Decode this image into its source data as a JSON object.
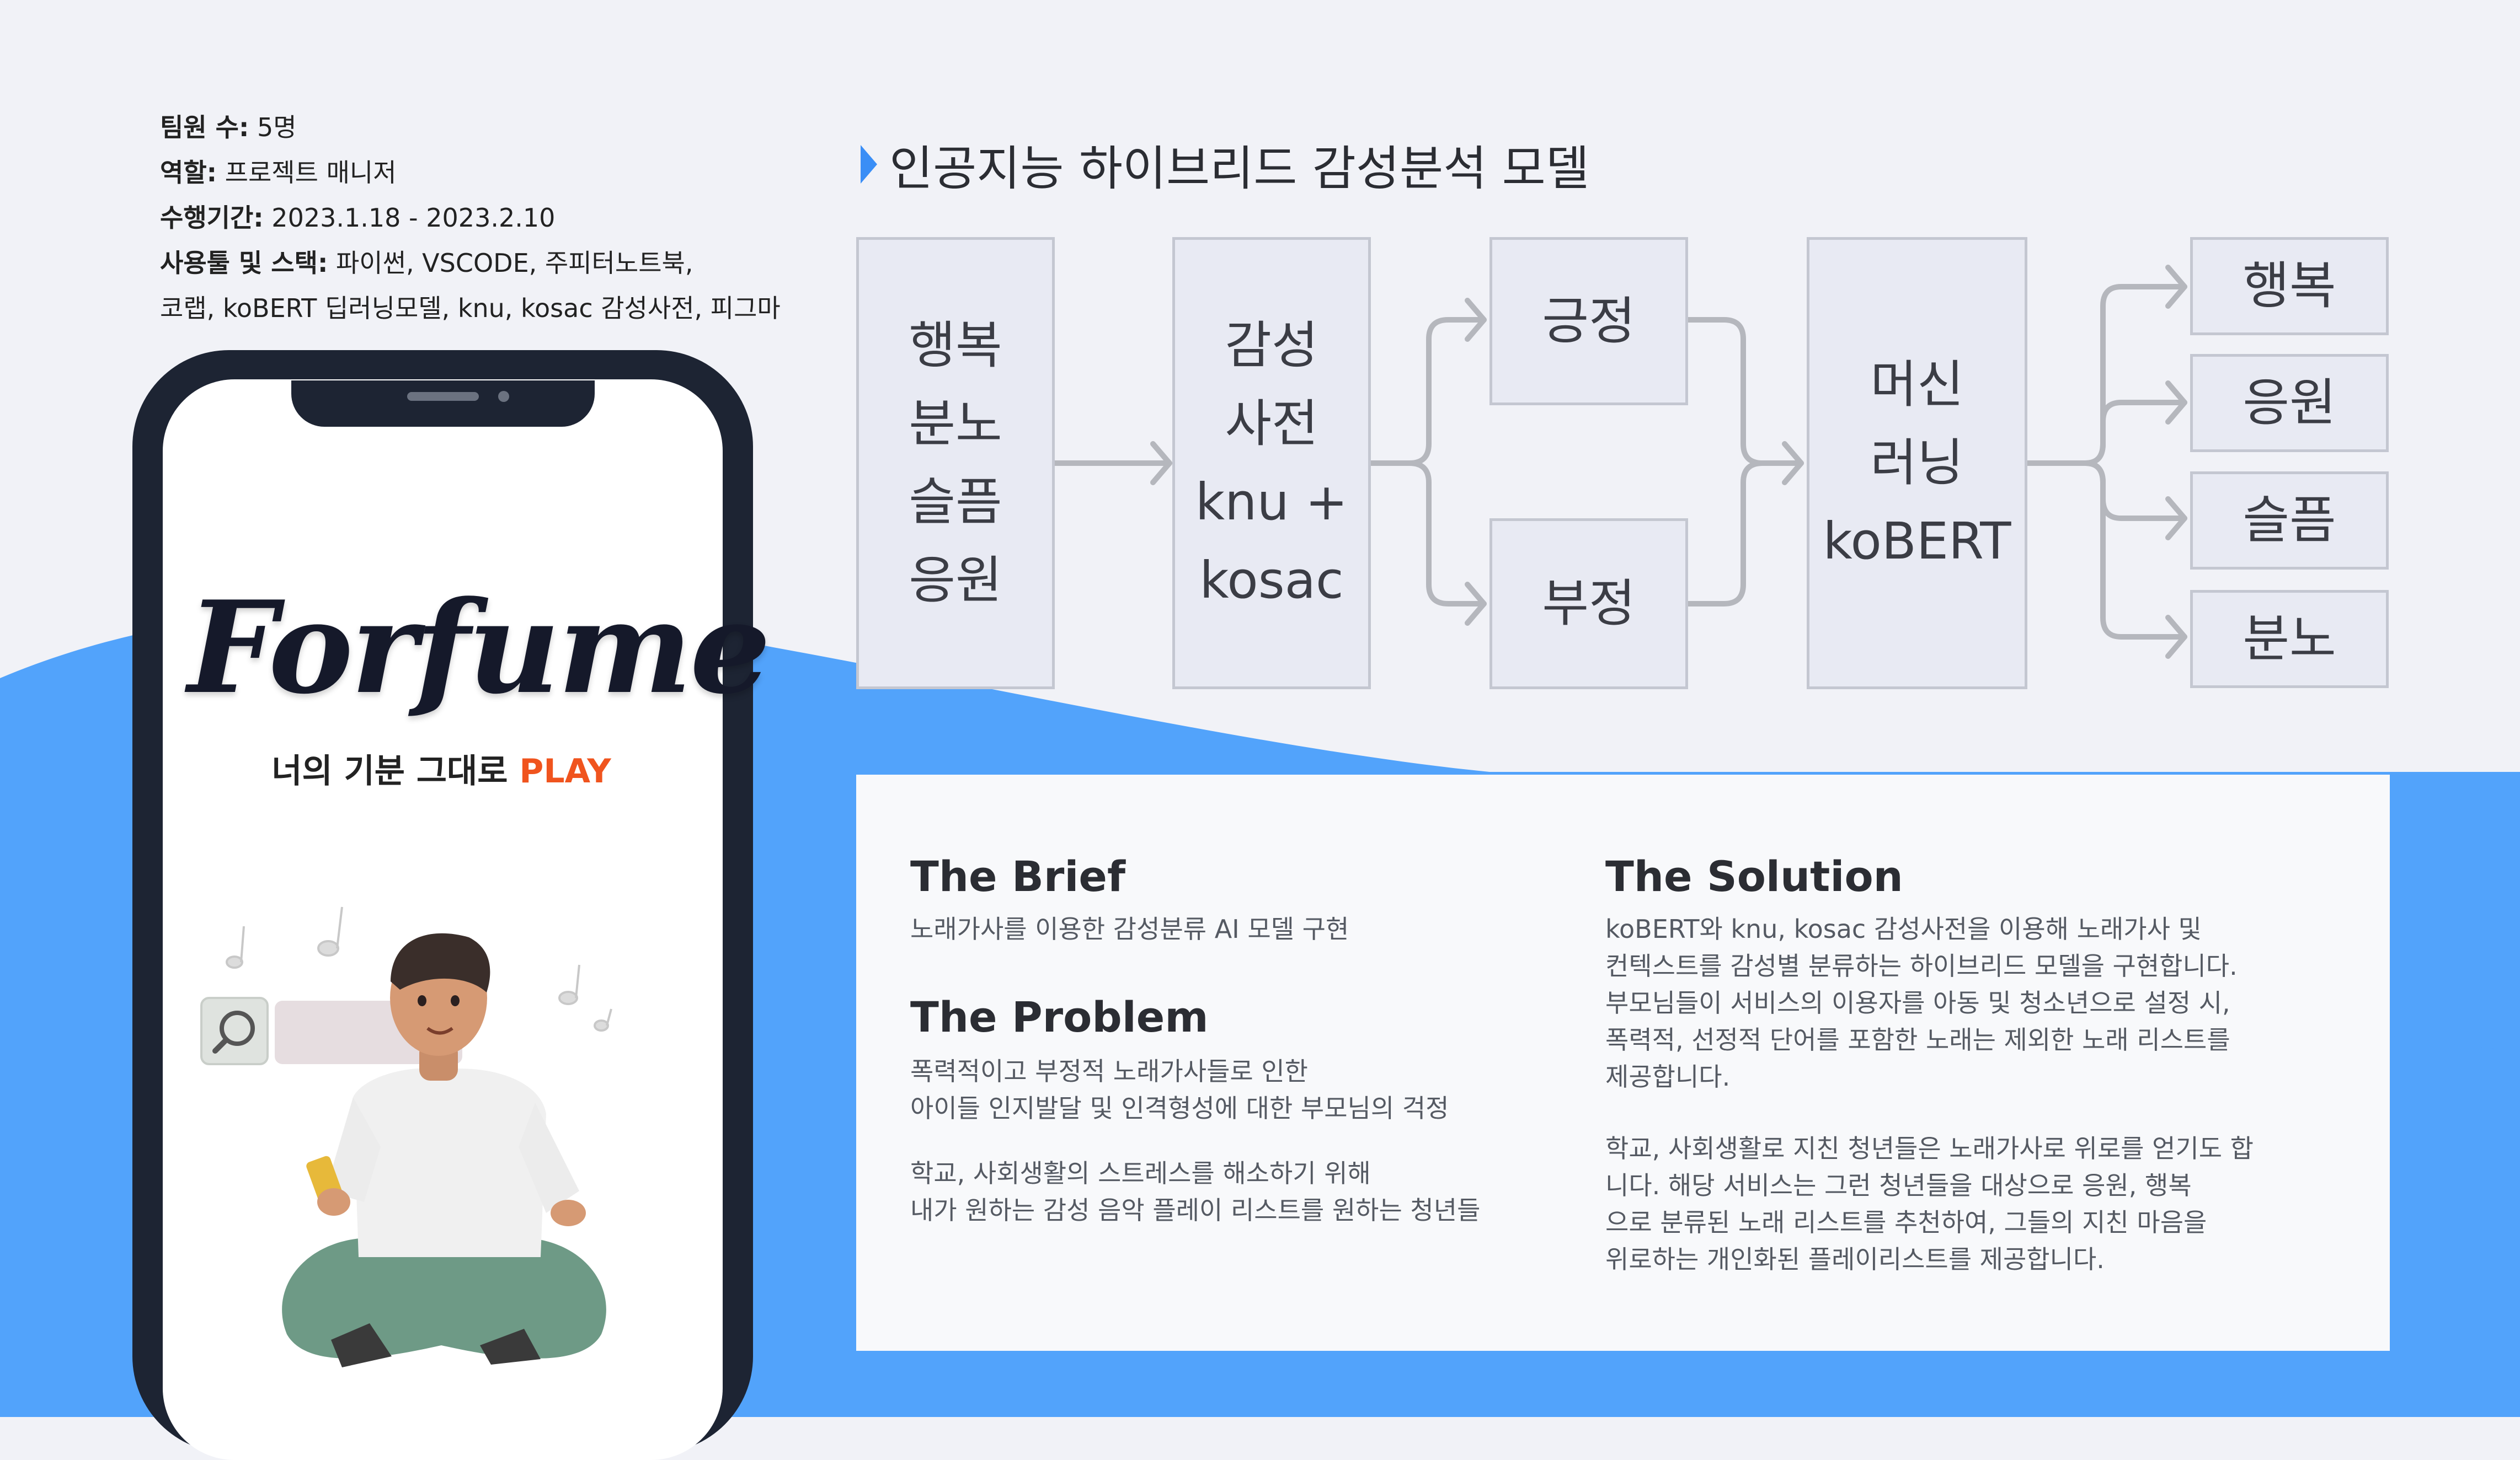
{
  "info": {
    "team_label": "팀원 수:",
    "team_value": " 5명",
    "role_label": "역할:",
    "role_value": " 프로젝트 매니저",
    "period_label": "수행기간:",
    "period_value": " 2023.1.18 - 2023.2.10",
    "tools_label": "사용툴 및 스택:",
    "tools_value": " 파이썬, VSCODE, 주피터노트북,",
    "tools_line2": "코랩, koBERT 딥러닝모델, knu, kosac 감성사전, 피그마"
  },
  "phone": {
    "logo": "Forfume",
    "tagline_main": "너의 기분 그대로 ",
    "tagline_accent": "PLAY"
  },
  "model": {
    "title": "인공지능 하이브리드 감성분석 모델",
    "input_box": [
      "행복",
      "분노",
      "슬픔",
      "응원"
    ],
    "dict_box": [
      "감성",
      "사전",
      "knu +",
      "kosac"
    ],
    "positive": "긍정",
    "negative": "부정",
    "ml_box": [
      "머신",
      "러닝",
      "koBERT"
    ],
    "outputs": [
      "행복",
      "응원",
      "슬픔",
      "분노"
    ]
  },
  "brief": {
    "heading": "The Brief",
    "text": "노래가사를 이용한 감성분류 AI 모델 구현"
  },
  "problem": {
    "heading": "The Problem",
    "text1": "폭력적이고 부정적 노래가사들로 인한\n아이들 인지발달 및 인격형성에 대한 부모님의 걱정",
    "text2": "학교, 사회생활의 스트레스를 해소하기 위해\n내가 원하는 감성 음악 플레이 리스트를 원하는 청년들"
  },
  "solution": {
    "heading": "The Solution",
    "text1": " koBERT와 knu, kosac 감성사전을 이용해 노래가사 및\n컨텍스트를 감성별 분류하는 하이브리드 모델을 구현합니다.\n부모님들이 서비스의 이용자를 아동 및 청소년으로 설정 시,\n폭력적, 선정적 단어를 포함한 노래는 제외한 노래 리스트를\n제공합니다.",
    "text2": "학교, 사회생활로 지친 청년들은 노래가사로 위로를 얻기도 합\n니다. 해당 서비스는 그런 청년들을 대상으로 응원, 행복\n으로 분류된 노래 리스트를 추천하여, 그들의 지친 마음을\n위로하는 개인화된 플레이리스트를 제공합니다."
  },
  "colors": {
    "background": "#f1f2f7",
    "wave_blue": "#52a3fb",
    "phone_frame": "#1d2433",
    "accent_orange": "#f0541e",
    "box_fill": "#e8eaf3",
    "arrow_gray": "#b5b7bd"
  }
}
